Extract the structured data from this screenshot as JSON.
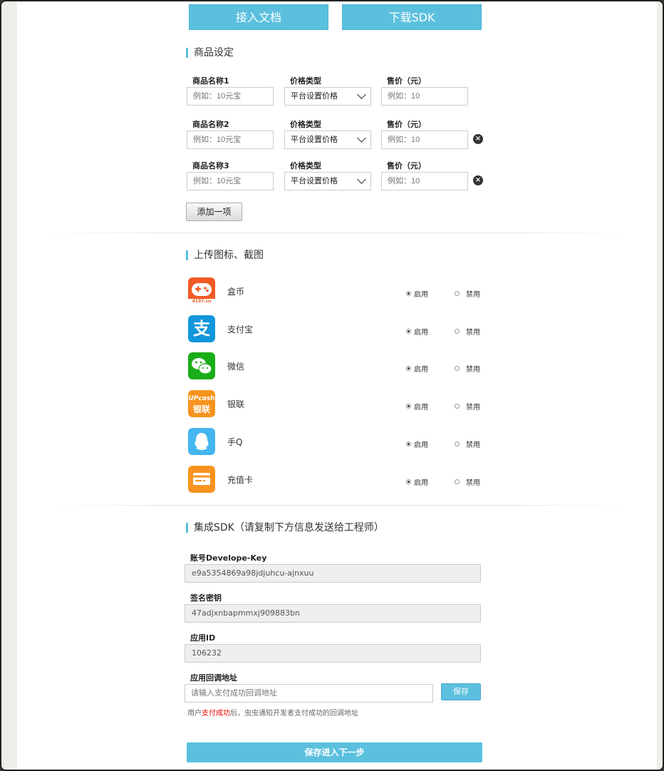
{
  "top_buttons": {
    "docs": "接入文档",
    "sdk": "下载SDK"
  },
  "products_section": {
    "title": "商品设定",
    "rows": [
      {
        "name_label": "商品名称1",
        "type_label": "价格类型",
        "price_label": "售价（元）",
        "name_placeholder": "例如：10元宝",
        "type_value": "平台设置价格",
        "price_placeholder": "例如：10",
        "removable": false
      },
      {
        "name_label": "商品名称2",
        "type_label": "价格类型",
        "price_label": "售价（元）",
        "name_placeholder": "例如：10元宝",
        "type_value": "平台设置价格",
        "price_placeholder": "例如：10",
        "removable": true
      },
      {
        "name_label": "商品名称3",
        "type_label": "价格类型",
        "price_label": "售价（元）",
        "name_placeholder": "例如：10元宝",
        "type_value": "平台设置价格",
        "price_placeholder": "例如：10",
        "removable": true
      }
    ],
    "add_label": "添加一项",
    "remove_glyph": "×"
  },
  "upload_section": {
    "title": "上传图标、截图",
    "enable_label": "启用",
    "disable_label": "禁用",
    "methods": [
      {
        "name": "盒币",
        "icon": "gamepad-icon",
        "color": "#f15a24",
        "enabled": true,
        "badge": "4197.cn"
      },
      {
        "name": "支付宝",
        "icon": "alipay-icon",
        "color": "#1296db",
        "enabled": true,
        "glyph": "支"
      },
      {
        "name": "微信",
        "icon": "wechat-icon",
        "color": "#1aad19",
        "enabled": true
      },
      {
        "name": "银联",
        "icon": "unionpay-icon",
        "color": "#f7931e",
        "enabled": true,
        "line1": "UPcash",
        "line2": "银联"
      },
      {
        "name": "手Q",
        "icon": "qq-icon",
        "color": "#44b6f0",
        "enabled": true
      },
      {
        "name": "充值卡",
        "icon": "card-icon",
        "color": "#f7931e",
        "enabled": true
      }
    ]
  },
  "sdk_section": {
    "title": "集成SDK（请复制下方信息发送给工程师）",
    "key_label": "账号Develope-Key",
    "key_value": "e9a5354869a98jdjuhcu-ajnxuu",
    "secret_label": "签名密钥",
    "secret_value": "47adjxnbapmmxj909883bn",
    "appid_label": "应用ID",
    "appid_value": "106232",
    "callback_label": "应用回调地址",
    "callback_placeholder": "请输入支付成功回调地址",
    "save_label": "保存",
    "note_prefix": "用户",
    "note_highlight": "支付成功",
    "note_suffix": "后，虫虫通知开发者支付成功的回调地址"
  },
  "next_button": "保存进入下一步"
}
